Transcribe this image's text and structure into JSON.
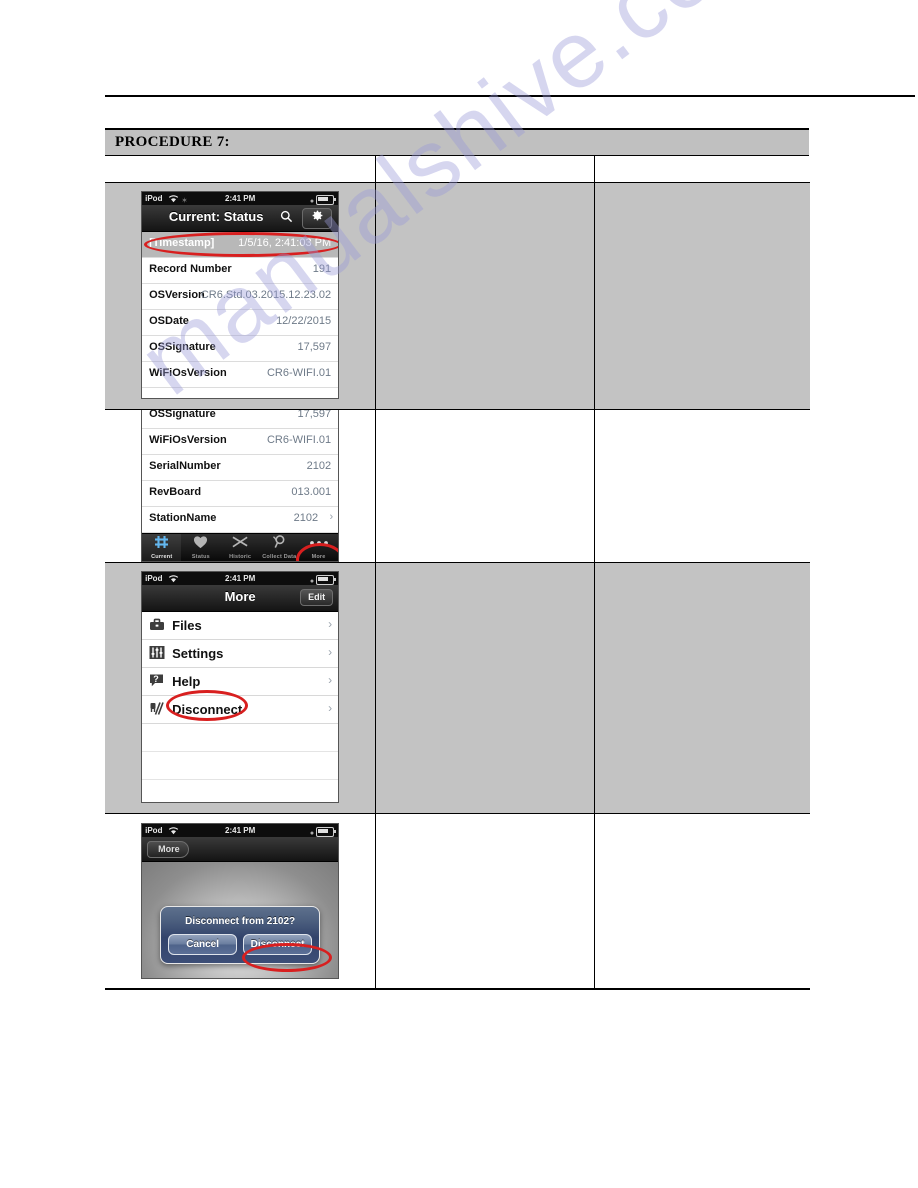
{
  "document": {
    "watermark": "manualshive.com",
    "procedure_title": "PROCEDURE 7:"
  },
  "panels": {
    "panel1": {
      "name": "current-status-screen",
      "statusbar": {
        "carrier": "iPod",
        "wifi_icon": "wifi-icon",
        "spinner_icon": "activity-icon",
        "time": "2:41 PM",
        "lock_icon": "lock-icon",
        "battery_icon": "battery-icon"
      },
      "navbar": {
        "title": "Current: Status",
        "search_icon": "search-icon",
        "gear_icon": "gear-icon"
      },
      "rows": [
        {
          "label": "[Timestamp]",
          "value": "1/5/16, 2:41:03 PM",
          "selected": true
        },
        {
          "label": "Record Number",
          "value": "191",
          "selected": false
        },
        {
          "label": "OSVersion",
          "value": "CR6.Std.03.2015.12.23.02",
          "selected": false
        },
        {
          "label": "OSDate",
          "value": "12/22/2015",
          "selected": false
        },
        {
          "label": "OSSignature",
          "value": "17,597",
          "selected": false
        },
        {
          "label": "WiFiOsVersion",
          "value": "CR6-WIFI.01",
          "selected": false
        }
      ]
    },
    "panel2": {
      "name": "status-list-scrolled-screen",
      "rows": [
        {
          "label": "OSSignature",
          "value": "17,597",
          "chevron": ""
        },
        {
          "label": "WiFiOsVersion",
          "value": "CR6-WIFI.01",
          "chevron": ""
        },
        {
          "label": "SerialNumber",
          "value": "2102",
          "chevron": ""
        },
        {
          "label": "RevBoard",
          "value": "013.001",
          "chevron": ""
        },
        {
          "label": "StationName",
          "value": "2102",
          "chevron": "›"
        }
      ],
      "tabs": [
        {
          "label": "Current",
          "icon": "grid-hash-icon",
          "active": true
        },
        {
          "label": "Status",
          "icon": "heart-icon",
          "active": false
        },
        {
          "label": "Historic",
          "icon": "chart-line-icon",
          "active": false
        },
        {
          "label": "Collect Data",
          "icon": "magnifier-data-icon",
          "active": false
        },
        {
          "label": "More",
          "icon": "ellipsis-icon",
          "active": false
        }
      ]
    },
    "panel3": {
      "name": "more-menu-screen",
      "statusbar": {
        "carrier": "iPod",
        "time": "2:41 PM"
      },
      "navbar": {
        "title": "More",
        "edit_label": "Edit"
      },
      "items": [
        {
          "label": "Files",
          "icon": "briefcase-icon",
          "chevron": "›"
        },
        {
          "label": "Settings",
          "icon": "sliders-icon",
          "chevron": "›"
        },
        {
          "label": "Help",
          "icon": "question-flag-icon",
          "chevron": "›"
        },
        {
          "label": "Disconnect",
          "icon": "plug-disconnect-icon",
          "chevron": "›"
        }
      ]
    },
    "panel4": {
      "name": "disconnect-alert-screen",
      "statusbar": {
        "carrier": "iPod",
        "time": "2:41 PM"
      },
      "navbar": {
        "back_label": "More"
      },
      "alert": {
        "message": "Disconnect from 2102?",
        "cancel_label": "Cancel",
        "confirm_label": "Disconnect"
      }
    }
  },
  "annotations": {
    "highlight_color": "#d81f1f",
    "targets": [
      "timestamp-row",
      "more-tab",
      "disconnect-menu-item",
      "disconnect-alert-button"
    ]
  }
}
